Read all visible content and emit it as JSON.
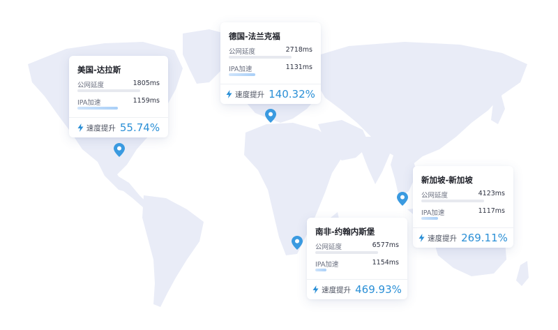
{
  "colors": {
    "accent": "#2a8fd6",
    "pin": "#3a9ae0",
    "land": "#e9ecf7",
    "bar_fill": "#bfdcf9",
    "bar_track": "#e7e9ef"
  },
  "icons": {
    "lightning": "lightning-icon",
    "pin": "map-pin-icon"
  },
  "cards": {
    "usa": {
      "title": "美国-达拉斯",
      "public_label": "公网延度",
      "public_value": "1805ms",
      "ipa_label": "IPA加速",
      "ipa_value": "1159ms",
      "speed_label": "速度提升",
      "speed_value": "55.74%"
    },
    "germany": {
      "title": "德国-法兰克福",
      "public_label": "公网延度",
      "public_value": "2718ms",
      "ipa_label": "IPA加速",
      "ipa_value": "1131ms",
      "speed_label": "速度提升",
      "speed_value": "140.32%"
    },
    "singapore": {
      "title": "新加坡-新加坡",
      "public_label": "公网延度",
      "public_value": "4123ms",
      "ipa_label": "IPA加速",
      "ipa_value": "1117ms",
      "speed_label": "速度提升",
      "speed_value": "269.11%"
    },
    "southafrica": {
      "title": "南非-约翰内斯堡",
      "public_label": "公网延度",
      "public_value": "6577ms",
      "ipa_label": "IPA加速",
      "ipa_value": "1154ms",
      "speed_label": "速度提升",
      "speed_value": "469.93%"
    }
  }
}
